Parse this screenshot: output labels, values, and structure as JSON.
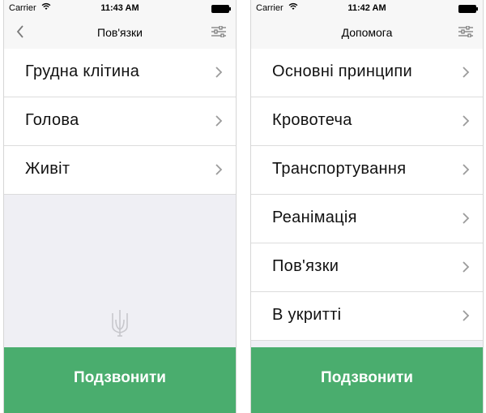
{
  "left": {
    "status": {
      "carrier": "Carrier",
      "time": "11:43 AM"
    },
    "title": "Пов'язки",
    "items": [
      {
        "label": "Грудна клітина"
      },
      {
        "label": "Голова"
      },
      {
        "label": "Живіт"
      }
    ],
    "call_label": "Подзвонити"
  },
  "right": {
    "status": {
      "carrier": "Carrier",
      "time": "11:42 AM"
    },
    "title": "Допомога",
    "items": [
      {
        "label": "Основні принципи"
      },
      {
        "label": "Кровотеча"
      },
      {
        "label": "Транспортування"
      },
      {
        "label": "Реанімація"
      },
      {
        "label": "Пов'язки"
      },
      {
        "label": "В укритті"
      }
    ],
    "call_label": "Подзвонити"
  },
  "colors": {
    "accent": "#4aad6e",
    "background": "#efeff4",
    "bar": "#f7f7f7"
  },
  "icons": [
    "back-arrow-icon",
    "settings-sliders-icon",
    "chevron-right-icon",
    "wifi-icon",
    "battery-icon",
    "trident-emblem-icon"
  ]
}
